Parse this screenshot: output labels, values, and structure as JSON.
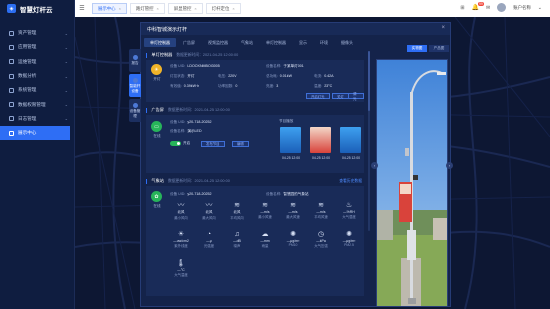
{
  "app": {
    "title": "智慧灯杆云"
  },
  "sidebar": {
    "items": [
      {
        "label": "资产管理"
      },
      {
        "label": "应用管理"
      },
      {
        "label": "运维管理"
      },
      {
        "label": "数据分析"
      },
      {
        "label": "系统管理"
      },
      {
        "label": "数据权限管理"
      },
      {
        "label": "日志管理"
      },
      {
        "label": "展示中心"
      }
    ]
  },
  "topbar": {
    "tabs": [
      {
        "label": "展示中心"
      },
      {
        "label": "路灯管控"
      },
      {
        "label": "屏显管控"
      },
      {
        "label": "灯杆定位"
      }
    ],
    "notify_count": "99",
    "user_name": "账户名称"
  },
  "modal": {
    "title": "中科智城演示灯杆",
    "side_tabs": [
      "报告",
      "智能杆设备",
      "设备管理"
    ],
    "tabs": [
      "单灯控制器",
      "广告屏",
      "视频监控器",
      "气象站",
      "单灯控制器",
      "显示",
      "环境",
      "摄像头"
    ],
    "lamp": {
      "title": "单灯控制器",
      "sub": "数据更新时间：2021-04-25 12:00:00",
      "status": "开灯",
      "rows": [
        [
          {
            "k": "设备 UID:",
            "v": "LDOOXNMBOI3005"
          },
          {
            "k": "设备名称:",
            "v": "于某单灯001"
          }
        ],
        [
          {
            "k": "灯控状态:",
            "v": "开灯"
          },
          {
            "k": "电压:",
            "v": "220V"
          },
          {
            "k": "总功耗:",
            "v": "0.01kW"
          },
          {
            "k": "电流:",
            "v": "0.42A"
          }
        ],
        [
          {
            "k": "有效值:",
            "v": "0.39kW·h"
          },
          {
            "k": "功率因数:",
            "v": "0"
          },
          {
            "k": "亮度:",
            "v": "3"
          },
          {
            "k": "温度:",
            "v": "23°C"
          }
        ]
      ],
      "buttons": [
        "开启灯光",
        "关灯",
        "调光"
      ]
    },
    "screen": {
      "title": "广告屏",
      "sub": "数据更新时间：2021-04-25 12:00:00",
      "status": "在线",
      "uid_k": "设备 UID:",
      "uid_v": "y20-718-20252",
      "name_k": "设备名称:",
      "name_v": "演示LED",
      "power_label": "开启",
      "buttons": [
        "发布节目",
        "编辑"
      ],
      "program_label": "节目播放",
      "posters": [
        {
          "label": "04-25 12:00",
          "color": "#2c86d9"
        },
        {
          "label": "04-25 12:00",
          "color": "#d9433b"
        },
        {
          "label": "04-25 12:00",
          "color": "#2c86d9"
        }
      ]
    },
    "weather": {
      "title": "气象站",
      "sub": "数据更新时间：2021-04-25 12:00:00",
      "more": "查看历史数据",
      "status": "在线",
      "uid_k": "设备 UID:",
      "uid_v": "y20-718-20252",
      "name_k": "设备名称:",
      "name_v": "智慧园的气象站",
      "metrics": [
        {
          "icon": "〰",
          "value": "北风",
          "label": "最小风向"
        },
        {
          "icon": "〰",
          "value": "北风",
          "label": "最大风向"
        },
        {
          "icon": "≋",
          "value": "北风",
          "label": "平均风向"
        },
        {
          "icon": "≋",
          "value": "—m/s",
          "label": "最小风速"
        },
        {
          "icon": "≋",
          "value": "—m/s",
          "label": "最大风速"
        },
        {
          "icon": "≋",
          "value": "—m/s",
          "label": "平均风速"
        },
        {
          "icon": "♨",
          "value": "—%RH",
          "label": "大气湿度"
        },
        {
          "icon": "☀",
          "value": "—uw/cm2",
          "label": "紫外线度"
        },
        {
          "icon": "◔",
          "value": "—μ",
          "label": "光强度"
        },
        {
          "icon": "♫",
          "value": "—dB",
          "label": "噪声"
        },
        {
          "icon": "☁",
          "value": "—mm",
          "label": "雨量"
        },
        {
          "icon": "✺",
          "value": "—μg/m³",
          "label": "PM10"
        },
        {
          "icon": "◷",
          "value": "—kPa",
          "label": "大气压强"
        },
        {
          "icon": "✺",
          "value": "—μg/m³",
          "label": "PM2.5"
        },
        {
          "icon": "🌡",
          "value": "—°C",
          "label": "大气温度"
        }
      ]
    },
    "right_tabs": [
      "实物图",
      "产品图"
    ]
  },
  "colors": {
    "accent": "#2e6ef5",
    "online": "#27b45a",
    "lamp": "#f0b429"
  }
}
